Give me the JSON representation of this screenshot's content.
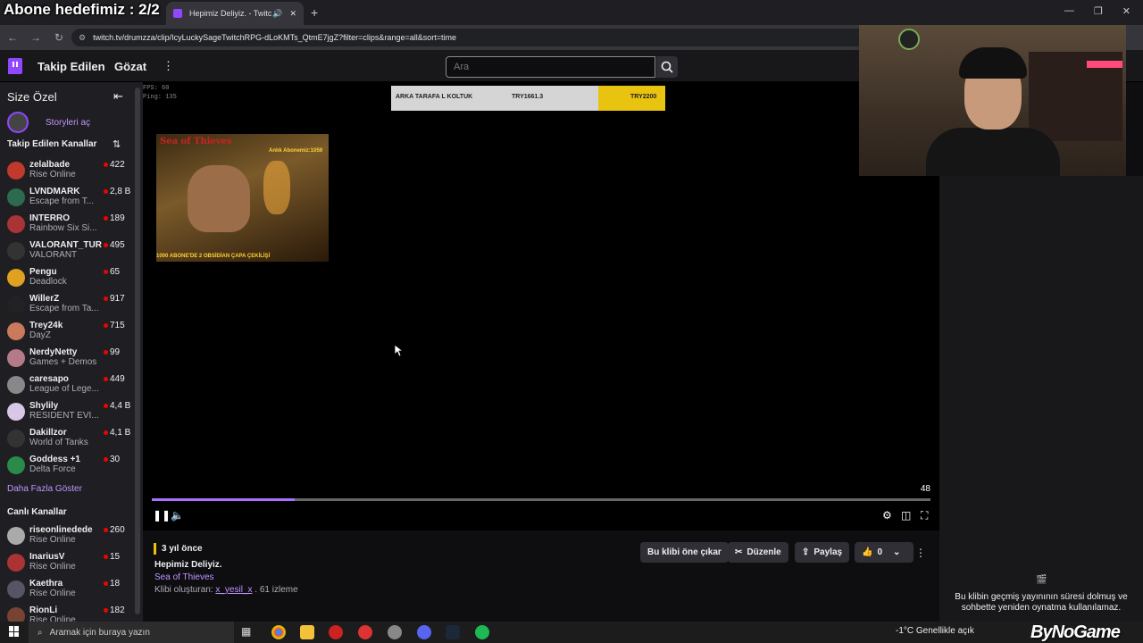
{
  "overlay": {
    "goal": "Abone hedefimiz : 2/2"
  },
  "browser": {
    "tab_title": "Hepimiz Deliyiz. - Twitch",
    "new_tab": "+",
    "url": "twitch.tv/drumzza/clip/IcyLuckySageTwitchRPG-dLoKMTs_QtmE7jgZ?filter=clips&range=all&sort=time"
  },
  "header": {
    "following": "Takip Edilen",
    "browse": "Gözat",
    "more": "⋮",
    "search_placeholder": "Ara"
  },
  "sidebar": {
    "title": "Size Özel",
    "stories": "Storyleri aç",
    "followed_heading": "Takip Edilen Kanallar",
    "show_more": "Daha Fazla Göster",
    "live_heading": "Canlı Kanallar",
    "followed": [
      {
        "name": "zelalbade",
        "game": "Rise Online",
        "viewers": "422",
        "color": "#c0392b"
      },
      {
        "name": "LVNDMARK",
        "game": "Escape from T...",
        "viewers": "2,8 B",
        "color": "#2d6a4f"
      },
      {
        "name": "INTERRO",
        "game": "Rainbow Six Si...",
        "viewers": "189",
        "color": "#a33"
      },
      {
        "name": "VALORANT_TUR",
        "game": "VALORANT",
        "viewers": "495",
        "color": "#333"
      },
      {
        "name": "Pengu",
        "game": "Deadlock",
        "viewers": "65",
        "color": "#e0a020"
      },
      {
        "name": "WillerZ",
        "game": "Escape from Ta...",
        "viewers": "917",
        "color": "#222"
      },
      {
        "name": "Trey24k",
        "game": "DayZ",
        "viewers": "715",
        "color": "#c87a5a"
      },
      {
        "name": "NerdyNetty",
        "game": "Games + Demos",
        "viewers": "99",
        "color": "#b47a8a"
      },
      {
        "name": "caresapo",
        "game": "League of Lege...",
        "viewers": "449",
        "color": "#888"
      },
      {
        "name": "Shylily",
        "game": "RESIDENT EVI...",
        "viewers": "4,4 B",
        "color": "#d8c8e8"
      },
      {
        "name": "Dakillzor",
        "game": "World of Tanks",
        "viewers": "4,1 B",
        "color": "#333"
      },
      {
        "name": "Goddess +1",
        "game": "Delta Force",
        "viewers": "30",
        "color": "#2a8a4a"
      }
    ],
    "live": [
      {
        "name": "riseonlinedede",
        "game": "Rise Online",
        "viewers": "260",
        "color": "#aaa"
      },
      {
        "name": "InariusV",
        "game": "Rise Online",
        "viewers": "15",
        "color": "#a33"
      },
      {
        "name": "Kaethra",
        "game": "Rise Online",
        "viewers": "18",
        "color": "#556"
      },
      {
        "name": "RionLi",
        "game": "Rise Online",
        "viewers": "182",
        "color": "#743"
      }
    ]
  },
  "player": {
    "stats_fps": "FPS:   60",
    "stats_ping": "Ping: 135",
    "donation_label": "ARKA TARAFA L KOLTUK",
    "donation_current": "TRY1661.3",
    "donation_goal": "TRY2200",
    "clip_logo": "Sea of Thieves",
    "clip_subcount": "Anlık Abonemiz:1059",
    "clip_caption": "1000 ABONE'DE 2 OBSİDİAN ÇAPA ÇEKİLİŞİ",
    "time_remaining": "48",
    "progress": 0.184
  },
  "clip": {
    "ago": "3 yıl önce",
    "title": "Hepimiz Deliyiz.",
    "game": "Sea of Thieves",
    "creator_prefix": "Klibi oluşturan:",
    "creator": "x_yesil_x",
    "views": ". 61 izleme",
    "feature_btn": "Bu klibi öne çıkar",
    "edit_btn": "Düzenle",
    "share_btn": "Paylaş",
    "likes": "0"
  },
  "notice": "Bu klibin geçmiş yayınının süresi dolmuş ve sohbette yeniden oynatma kullanılamaz.",
  "taskbar": {
    "search_placeholder": "Aramak için buraya yazın",
    "weather": "-1°C  Genellikle açık"
  },
  "watermark": "ByNoGame"
}
